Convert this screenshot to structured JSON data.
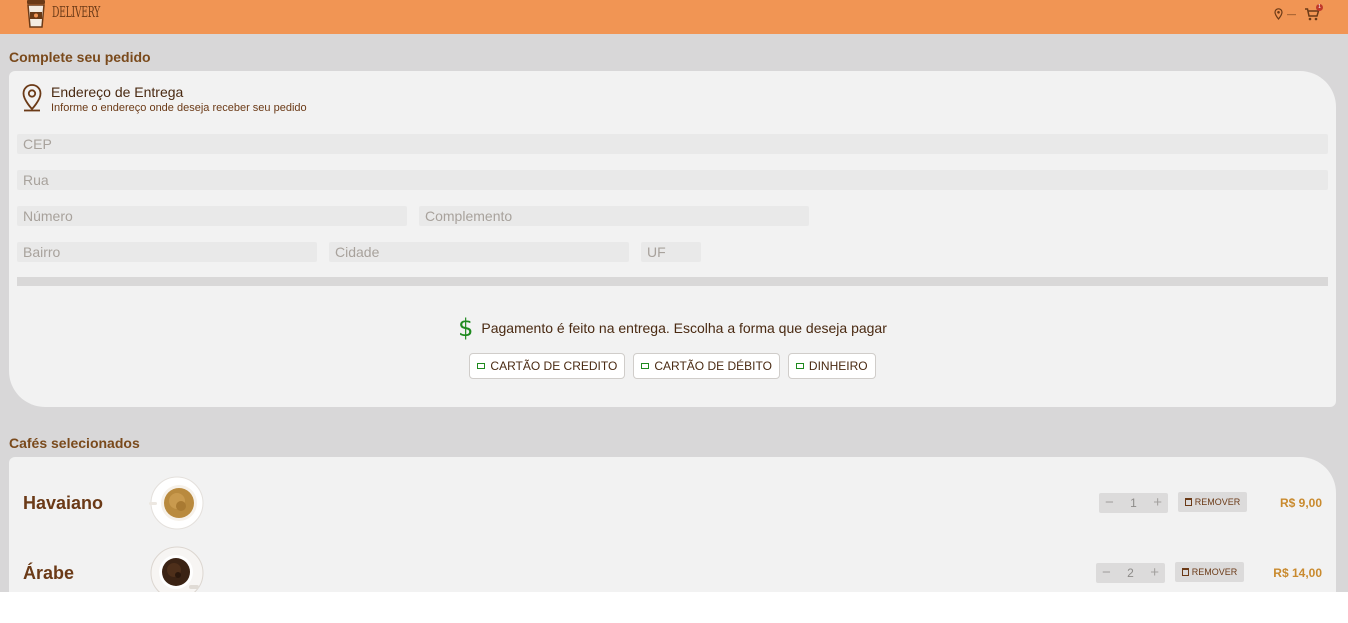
{
  "header": {
    "brand": "DELIVERY",
    "location": "—",
    "cart_count": "1",
    "colors": {
      "bar": "#f19554"
    }
  },
  "address_section": {
    "title": "Complete seu pedido",
    "card_title": "Endereço de Entrega",
    "card_subtitle": "Informe o endereço onde deseja receber seu pedido",
    "fields": {
      "cep": {
        "placeholder": "CEP",
        "value": ""
      },
      "rua": {
        "placeholder": "Rua",
        "value": ""
      },
      "numero": {
        "placeholder": "Número",
        "value": ""
      },
      "complemento": {
        "placeholder": "Complemento",
        "value": ""
      },
      "bairro": {
        "placeholder": "Bairro",
        "value": ""
      },
      "cidade": {
        "placeholder": "Cidade",
        "value": ""
      },
      "uf": {
        "placeholder": "UF",
        "value": ""
      }
    }
  },
  "payment": {
    "icon": "dollar-icon",
    "text": "Pagamento é feito na entrega. Escolha a forma que deseja pagar",
    "options": [
      {
        "label": "CARTÃO DE CREDITO",
        "icon": "credit-card-icon"
      },
      {
        "label": "CARTÃO DE DÉBITO",
        "icon": "debit-card-icon"
      },
      {
        "label": "DINHEIRO",
        "icon": "money-icon"
      }
    ]
  },
  "cart": {
    "title": "Cafés selecionados",
    "remove_label": "REMOVER",
    "items": [
      {
        "name": "Havaiano",
        "quantity": "1",
        "price": "R$ 9,00"
      },
      {
        "name": "Árabe",
        "quantity": "2",
        "price": "R$ 14,00"
      }
    ]
  }
}
